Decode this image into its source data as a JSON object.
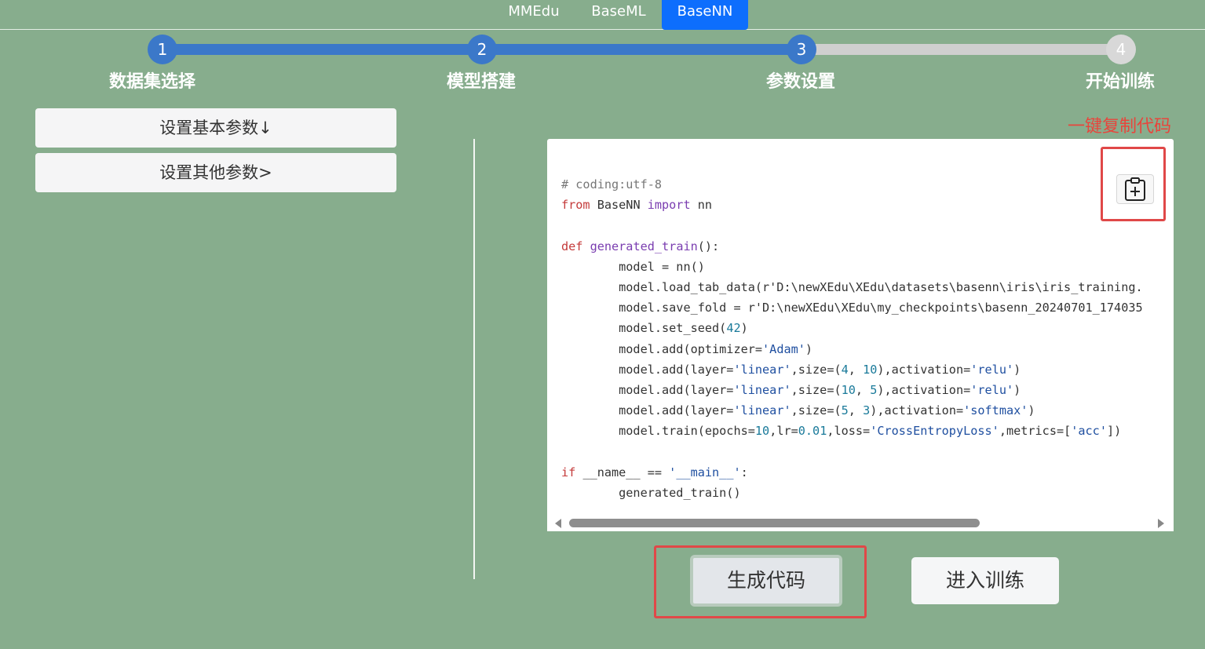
{
  "nav": {
    "tabs": [
      {
        "label": "MMEdu",
        "active": false
      },
      {
        "label": "BaseML",
        "active": false
      },
      {
        "label": "BaseNN",
        "active": true
      }
    ]
  },
  "stepper": {
    "steps": [
      {
        "number": "1",
        "label": "数据集选择",
        "state": "completed"
      },
      {
        "number": "2",
        "label": "模型搭建",
        "state": "completed"
      },
      {
        "number": "3",
        "label": "参数设置",
        "state": "current"
      },
      {
        "number": "4",
        "label": "开始训练",
        "state": "pending"
      }
    ]
  },
  "left_panel": {
    "basic_params_label": "设置基本参数↓",
    "other_params_label": "设置其他参数>"
  },
  "annotation": {
    "copy_hint": "一键复制代码",
    "color": "#e8453c"
  },
  "code": {
    "lines": [
      "# coding:utf-8",
      "from BaseNN import nn",
      "",
      "def generated_train():",
      "        model = nn()",
      "        model.load_tab_data(r'D:\\newXEdu\\XEdu\\datasets\\basenn\\iris\\iris_training.",
      "        model.save_fold = r'D:\\newXEdu\\XEdu\\my_checkpoints\\basenn_20240701_174035",
      "        model.set_seed(42)",
      "        model.add(optimizer='Adam')",
      "        model.add(layer='linear',size=(4, 10),activation='relu')",
      "        model.add(layer='linear',size=(10, 5),activation='relu')",
      "        model.add(layer='linear',size=(5, 3),activation='softmax')",
      "        model.train(epochs=10,lr=0.01,loss='CrossEntropyLoss',metrics=['acc'])",
      "",
      "if __name__ == '__main__':",
      "        generated_train()"
    ],
    "copy_icon": "clipboard-plus-icon"
  },
  "actions": {
    "generate_label": "生成代码",
    "train_label": "进入训练"
  },
  "colors": {
    "background": "#87ad8d",
    "active_tab": "#0d6efd",
    "step_blue": "#3b78c9",
    "step_grey": "#cfcfcf",
    "highlight_box": "#e04848"
  }
}
